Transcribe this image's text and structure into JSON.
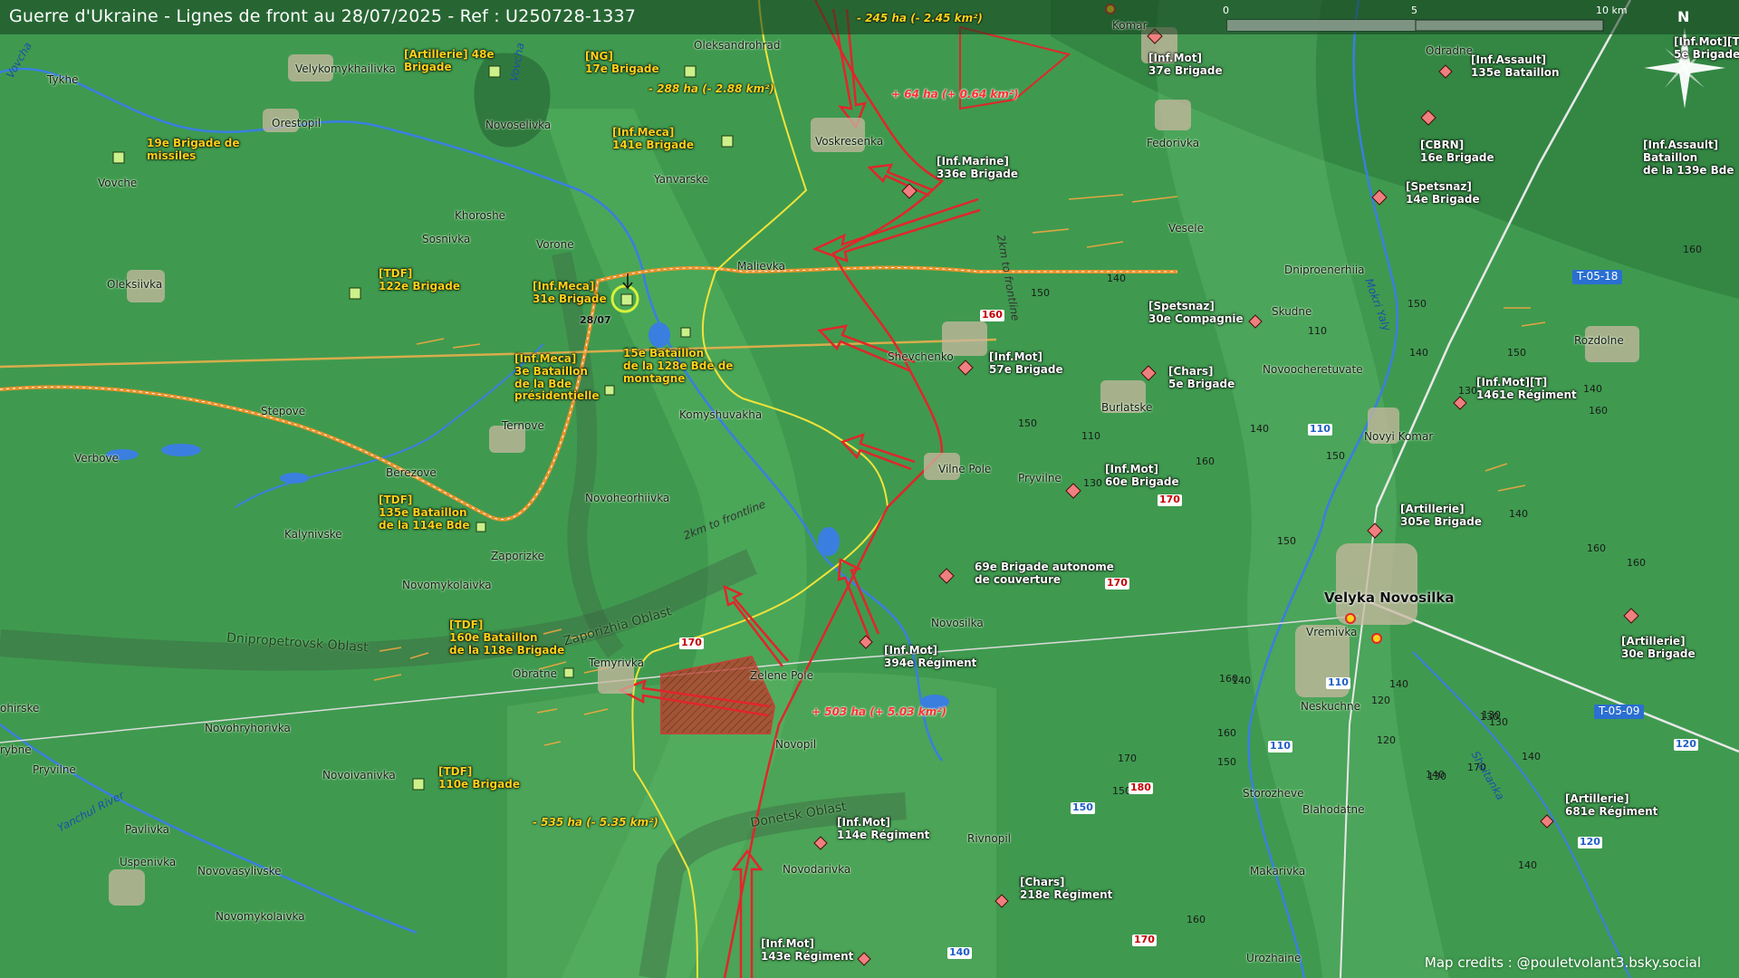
{
  "title": "Guerre d'Ukraine - Lignes de front au 28/07/2025 - Ref : U250728-1337",
  "credits": "Map credits : @pouletvolant3.bsky.social",
  "scale": {
    "ticks": [
      "0",
      "5",
      "10 km"
    ]
  },
  "north": "N",
  "towns": {
    "oleksandrohrad": "Oleksandrohrad",
    "velykomykhailivka": "Velykomykhailivka",
    "tykhe": "Tykhe",
    "orestopil": "Orestopil",
    "novoselivka": "Novoselivka",
    "yanvarske": "Yanvarske",
    "voskresenka": "Voskresenka",
    "komar": "Komar",
    "fedorivka": "Fedorivka",
    "odradne": "Odradne",
    "vovche": "Vovche",
    "khoroshe": "Khoroshe",
    "sosnivka": "Sosnivka",
    "vorone": "Vorone",
    "malievka": "Malievka",
    "veselo": "Vesele",
    "dniproenerhiia": "Dniproenerhiia",
    "skudne": "Skudne",
    "oleksiivka": "Oleksiivka",
    "shevchenko": "Shevchenko",
    "novoocheretuvate": "Novoocheretuvate",
    "rozdolne": "Rozdolne",
    "stepove": "Stepove",
    "ternove": "Ternove",
    "komyshuvakha": "Komyshuvakha",
    "burlatske": "Burlatske",
    "verbove": "Verbove",
    "novyi_komar": "Novyi Komar",
    "berezove": "Berezove",
    "vilne_pole": "Vilne Pole",
    "pryvilne": "Pryvilne",
    "novoheorhiivka": "Novoheorhiivka",
    "kalynivske": "Kalynivske",
    "zaporizke": "Zaporizke",
    "novomykolaivka": "Novomykolaivka",
    "velyka_novosilka": "Velyka Novosilka",
    "vremivka": "Vremivka",
    "novosilka": "Novosilka",
    "temyrivka": "Temyrivka",
    "obratne": "Obratne",
    "zelene_pole": "Zelene Pole",
    "neskuchne": "Neskuchne",
    "novopil": "Novopil",
    "ohirske": "ohirske",
    "novohryhorivka": "Novohryhorivka",
    "rybne": "rybne",
    "pryvilne_w": "Pryvilne",
    "novoivanivka": "Novoivanivka",
    "storozheve": "Storozheve",
    "blahodatne": "Blahodatne",
    "pavlivka": "Pavlivka",
    "uspenivka": "Uspenivka",
    "novovasylivske": "Novovasylivske",
    "novodarivka": "Novodarivka",
    "rivnopil": "Rivnopil",
    "makarivka": "Makarivka",
    "novomykolaivka_s": "Novomykolaivka",
    "urozhaine": "Urozhaine"
  },
  "oblasts": {
    "dnipropetrovsk": "Dnipropetrovsk Oblast",
    "zaporizhia": "Zaporizhia Oblast",
    "donetsk": "Donetsk Oblast"
  },
  "rivers": {
    "vovcha_w": "Vovcha",
    "vovcha": "Vovcha",
    "mokri_yaly": "Mokri Yaly",
    "shaitanka": "Shaitanka",
    "yanchul": "Yanchul River"
  },
  "frontline_notes": {
    "n2km_a": "2km to frontline",
    "n2km_b": "2km to frontline"
  },
  "area_changes": {
    "top_loss": "- 245 ha (- 2.45 km²)",
    "top_gain": "+ 64 ha (+ 0.64 km²)",
    "left_loss": "- 288 ha (- 2.88 km²)",
    "mid_gain": "+ 503 ha (+ 5.03 km²)",
    "bottom_loss": "- 535 ha (- 5.35 km²)"
  },
  "date_marker": "28/07",
  "units_ua": {
    "art48": "[Artillerie] 48e\nBrigade",
    "ng17": "[NG]\n17e Brigade",
    "missiles19": "19e Brigade de\nmissiles",
    "mec141": "[Inf.Meca]\n141e Brigade",
    "tdf122": "[TDF]\n122e Brigade",
    "mec31": "[Inf.Meca]\n31e Brigade",
    "bat15": "15e Bataillon\nde la 128e Bde de\nmontagne",
    "mec3": "[Inf.Meca]\n3e Bataillon\nde la Bde\nprésidentielle",
    "tdf135": "[TDF]\n135e Bataillon\nde la 114e Bde",
    "tdf160": "[TDF]\n160e Bataillon\nde la 118e Brigade",
    "tdf110": "[TDF]\n110e Brigade"
  },
  "units_ru": {
    "mot37": "[Inf.Mot]\n37e Brigade",
    "mott": "[Inf.Mot][T]\n5e Brigade",
    "assault135": "[Inf.Assault]\n135e Bataillon",
    "marine336": "[Inf.Marine]\n336e Brigade",
    "cbrn16": "[CBRN]\n16e Brigade",
    "assault139": "[Inf.Assault]\nBataillon\nde la 139e Bde",
    "spetsnaz14": "[Spetsnaz]\n14e Brigade",
    "spetsnaz30": "[Spetsnaz]\n30e Compagnie",
    "mot57": "[Inf.Mot]\n57e Brigade",
    "chars5": "[Chars]\n5e Brigade",
    "mot1461": "[Inf.Mot][T]\n1461e Régiment",
    "mot60": "[Inf.Mot]\n60e Brigade",
    "art305": "[Artillerie]\n305e Brigade",
    "b69": "69e Brigade autonome\nde couverture",
    "mot394": "[Inf.Mot]\n394e Régiment",
    "art30": "[Artillerie]\n30e Brigade",
    "mot114": "[Inf.Mot]\n114e Régiment",
    "chars218": "[Chars]\n218e Régiment",
    "art681": "[Artillerie]\n681e Régiment",
    "mot143": "[Inf.Mot]\n143e Régiment"
  },
  "elevations": [
    "140",
    "150",
    "160",
    "150",
    "110",
    "140",
    "150",
    "130",
    "140",
    "160",
    "150",
    "140",
    "160",
    "110",
    "130",
    "150",
    "160",
    "150",
    "140",
    "160",
    "130",
    "140",
    "140",
    "120",
    "170",
    "160",
    "150",
    "160",
    "140",
    "170",
    "130",
    "130",
    "120",
    "140",
    "150",
    "140",
    "130",
    "160"
  ],
  "elevations_red": [
    "160",
    "170",
    "170",
    "170",
    "180",
    "170"
  ],
  "elevations_blue": [
    "110",
    "110",
    "110",
    "150",
    "140",
    "120",
    "120"
  ],
  "road_signs": {
    "t0518": "T-05-18",
    "t0509": "T-05-09"
  },
  "colors": {
    "map_green": "#3f9a4f",
    "russian_red": "#e0262b",
    "ukrainian_yellow": "#ffd21a",
    "frontline_yellow": "#f3e33a",
    "roads_orange": "#f39b2d",
    "water_blue": "#3a7ee0"
  }
}
